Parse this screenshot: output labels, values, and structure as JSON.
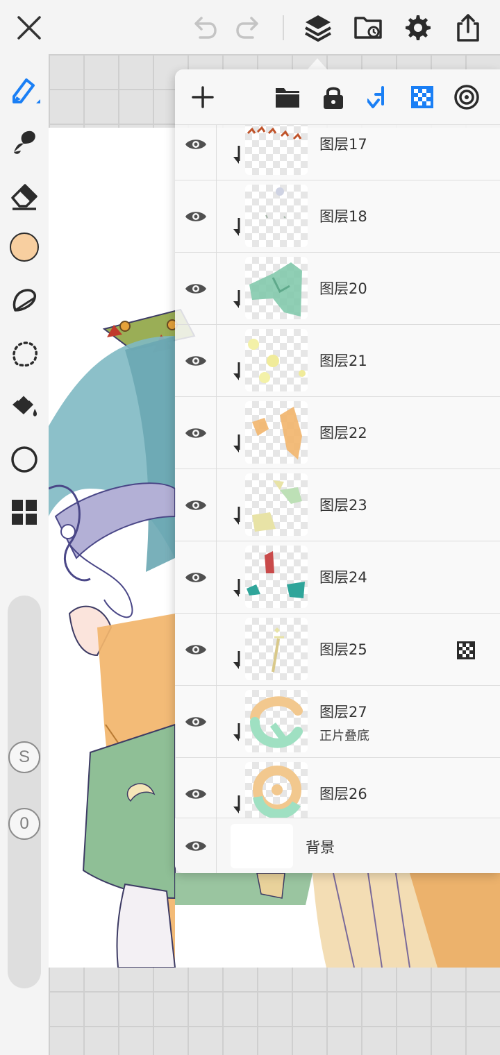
{
  "topbar": {
    "icons": [
      "close-icon",
      "undo-icon",
      "redo-icon",
      "layers-icon",
      "folder-icon",
      "settings-icon",
      "share-icon"
    ]
  },
  "tools": {
    "icons": [
      "brush-icon",
      "smudge-icon",
      "eraser-icon",
      "color-swatch",
      "lasso-icon",
      "selection-icon",
      "fill-icon",
      "shape-icon",
      "gallery-icon"
    ],
    "current_color": "#f8cfa0",
    "size_label": "S",
    "opacity_label": "0",
    "active_color": "#1a7ff5"
  },
  "layers_panel": {
    "toolbar_icons": [
      "add-layer-icon",
      "folder-icon",
      "lock-icon",
      "clip-icon",
      "alpha-lock-icon",
      "blend-mode-icon"
    ],
    "layers": [
      {
        "name": "图层17",
        "mode": "",
        "clipped": true,
        "checker_badge": false
      },
      {
        "name": "图层18",
        "mode": "",
        "clipped": true,
        "checker_badge": false
      },
      {
        "name": "图层20",
        "mode": "",
        "clipped": true,
        "checker_badge": false
      },
      {
        "name": "图层21",
        "mode": "",
        "clipped": true,
        "checker_badge": false
      },
      {
        "name": "图层22",
        "mode": "",
        "clipped": true,
        "checker_badge": false
      },
      {
        "name": "图层23",
        "mode": "",
        "clipped": true,
        "checker_badge": false
      },
      {
        "name": "图层24",
        "mode": "",
        "clipped": true,
        "checker_badge": false
      },
      {
        "name": "图层25",
        "mode": "",
        "clipped": true,
        "checker_badge": true
      },
      {
        "name": "图层27",
        "mode": "正片叠底",
        "clipped": true,
        "checker_badge": false
      },
      {
        "name": "图层26",
        "mode": "",
        "clipped": true,
        "checker_badge": false
      }
    ],
    "background_label": "背景"
  }
}
